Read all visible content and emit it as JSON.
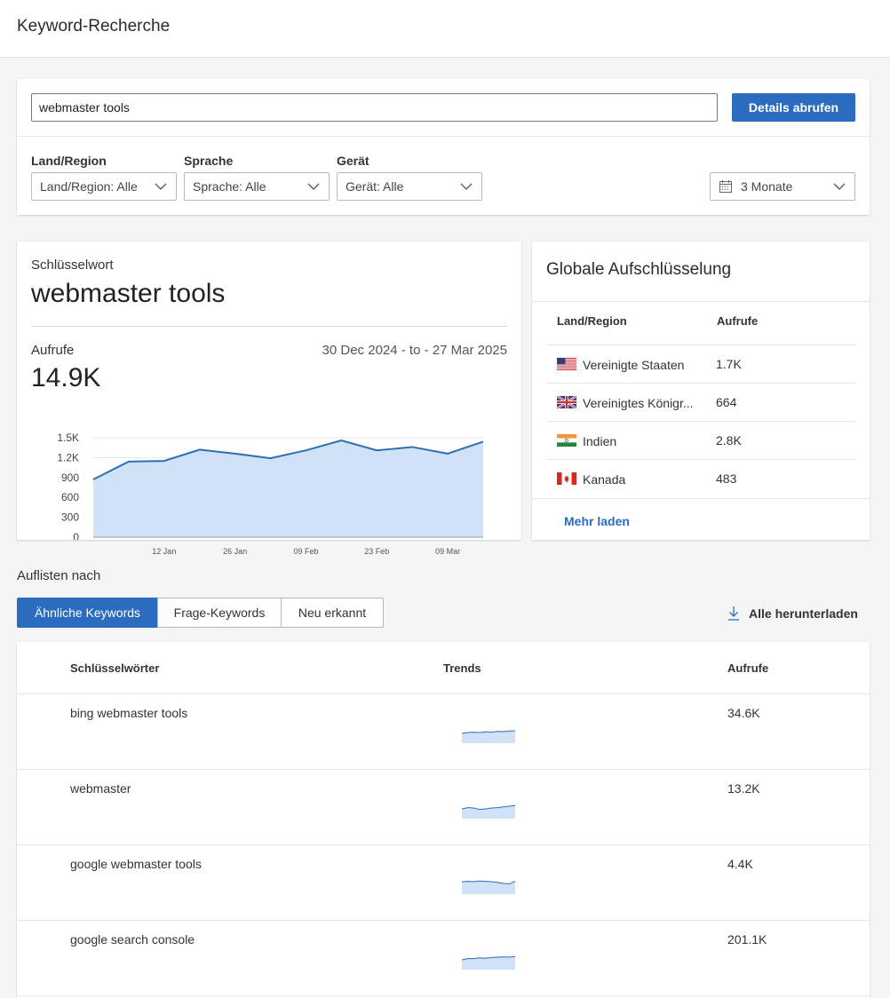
{
  "header": {
    "title": "Keyword-Recherche"
  },
  "search": {
    "value": "webmaster tools",
    "submit_label": "Details abrufen"
  },
  "filters": {
    "region": {
      "label": "Land/Region",
      "value": "Land/Region: Alle"
    },
    "language": {
      "label": "Sprache",
      "value": "Sprache: Alle"
    },
    "device": {
      "label": "Gerät",
      "value": "Gerät: Alle"
    },
    "period": {
      "value": "3 Monate",
      "icon": "calendar-icon"
    }
  },
  "keyword_card": {
    "kicker": "Schlüsselwort",
    "keyword": "webmaster tools",
    "calls_label": "Aufrufe",
    "calls_value": "14.9K",
    "date_range": "30 Dec 2024 - to - 27 Mar 2025"
  },
  "chart_data": {
    "type": "area",
    "x": [
      "29 Dec",
      "05 Jan",
      "12 Jan",
      "19 Jan",
      "26 Jan",
      "02 Feb",
      "09 Feb",
      "16 Feb",
      "23 Feb",
      "02 Mar",
      "09 Mar",
      "16 Mar",
      "23 Mar"
    ],
    "x_tick_labels": [
      "12 Jan",
      "26 Jan",
      "09 Feb",
      "23 Feb",
      "09 Mar"
    ],
    "y_tick_labels": [
      "0",
      "300",
      "600",
      "900",
      "1.2K",
      "1.5K"
    ],
    "values": [
      870,
      1140,
      1150,
      1320,
      1260,
      1190,
      1310,
      1460,
      1310,
      1360,
      1260,
      1440
    ],
    "ylim": [
      0,
      1500
    ],
    "colors": {
      "line": "#2f6db5",
      "fill": "#d0e2f6",
      "grid": "#e4e4e4"
    }
  },
  "global": {
    "title": "Globale Aufschlüsselung",
    "col_country": "Land/Region",
    "col_views": "Aufrufe",
    "rows": [
      {
        "country": "Vereinigte Staaten",
        "views": "1.7K",
        "flag": "us-flag-icon"
      },
      {
        "country": "Vereinigtes Königr...",
        "views": "664",
        "flag": "uk-flag-icon"
      },
      {
        "country": "Indien",
        "views": "2.8K",
        "flag": "india-flag-icon"
      },
      {
        "country": "Kanada",
        "views": "483",
        "flag": "canada-flag-icon"
      }
    ],
    "more_label": "Mehr laden"
  },
  "list": {
    "label": "Auflisten nach",
    "tabs": [
      "Ähnliche Keywords",
      "Frage-Keywords",
      "Neu erkannt"
    ],
    "active_tab": 0,
    "download_label": "Alle herunterladen"
  },
  "table": {
    "col_keywords": "Schlüsselwörter",
    "col_trends": "Trends",
    "col_views": "Aufrufe",
    "rows": [
      {
        "keyword": "bing webmaster tools",
        "views": "34.6K",
        "trend": [
          0.55,
          0.6,
          0.62,
          0.6,
          0.64,
          0.62,
          0.66,
          0.65,
          0.68,
          0.7
        ]
      },
      {
        "keyword": "webmaster",
        "views": "13.2K",
        "trend": [
          0.55,
          0.62,
          0.6,
          0.52,
          0.55,
          0.6,
          0.62,
          0.66,
          0.7,
          0.74
        ]
      },
      {
        "keyword": "google webmaster tools",
        "views": "4.4K",
        "trend": [
          0.7,
          0.72,
          0.7,
          0.74,
          0.72,
          0.7,
          0.66,
          0.6,
          0.58,
          0.72
        ]
      },
      {
        "keyword": "google search console",
        "views": "201.1K",
        "trend": [
          0.55,
          0.62,
          0.62,
          0.66,
          0.64,
          0.68,
          0.7,
          0.72,
          0.7,
          0.74
        ]
      }
    ]
  }
}
